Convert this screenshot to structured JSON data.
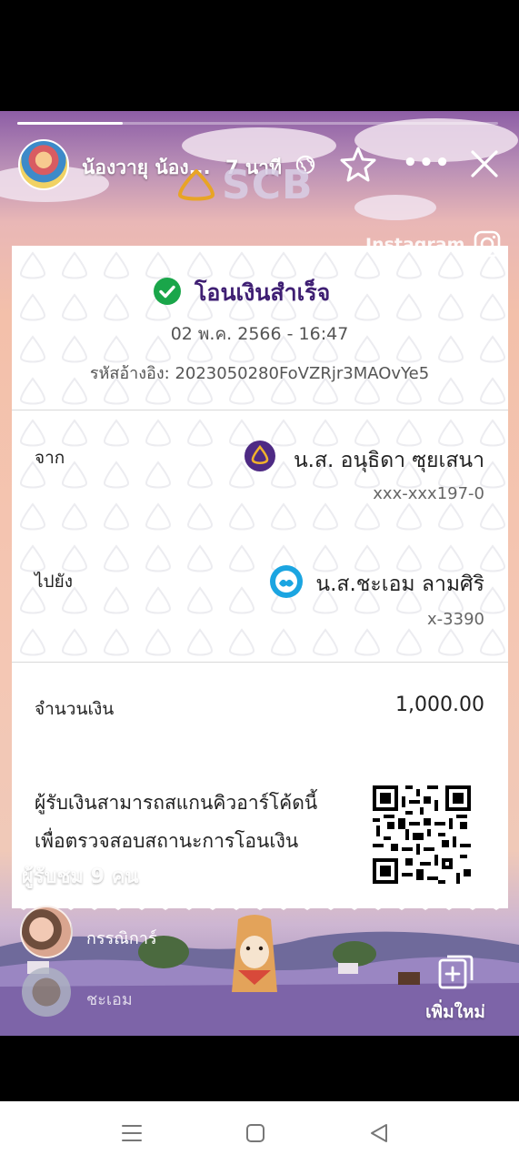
{
  "story": {
    "user_name": "น้องวายุ น้อง...",
    "time_ago": "7 นาที",
    "progress": 0.22,
    "watermark": "Instagram",
    "viewers_label": "ผู้รับชม 9 คน",
    "viewers": [
      {
        "name": "กรรณิการ์"
      },
      {
        "name": "ชะเอม"
      }
    ],
    "add_new_label": "เพิ่มใหม่",
    "brand": "SCB"
  },
  "slip": {
    "status": "โอนเงินสำเร็จ",
    "datetime": "02 พ.ค. 2566 - 16:47",
    "reference": "รหัสอ้างอิง: 2023050280FoVZRjr3MAOvYe5",
    "from_label": "จาก",
    "from_name": "น.ส. อนุธิดา ซุยเสนา",
    "from_account": "xxx-xxx197-0",
    "to_label": "ไปยัง",
    "to_name": "น.ส.ชะเอม ลามศิริ",
    "to_account": "x-3390",
    "amount_label": "จำนวนเงิน",
    "amount": "1,000.00",
    "qr_caption_line1": "ผู้รับเงินสามารถสแกนคิวอาร์โค้ดนี้",
    "qr_caption_line2": "เพื่อตรวจสอบสถานะการโอนเงิน"
  },
  "colors": {
    "scb_purple": "#4e2a84",
    "success_green": "#1aa64a",
    "ktb_blue": "#1ba5e1"
  },
  "icons": [
    "globe-icon",
    "star-icon",
    "more-icon",
    "close-icon",
    "instagram-icon",
    "check-circle-icon",
    "scb-bank-icon",
    "ktb-bank-icon",
    "qr-code-icon",
    "add-story-icon",
    "menu-icon",
    "home-icon",
    "back-icon"
  ]
}
